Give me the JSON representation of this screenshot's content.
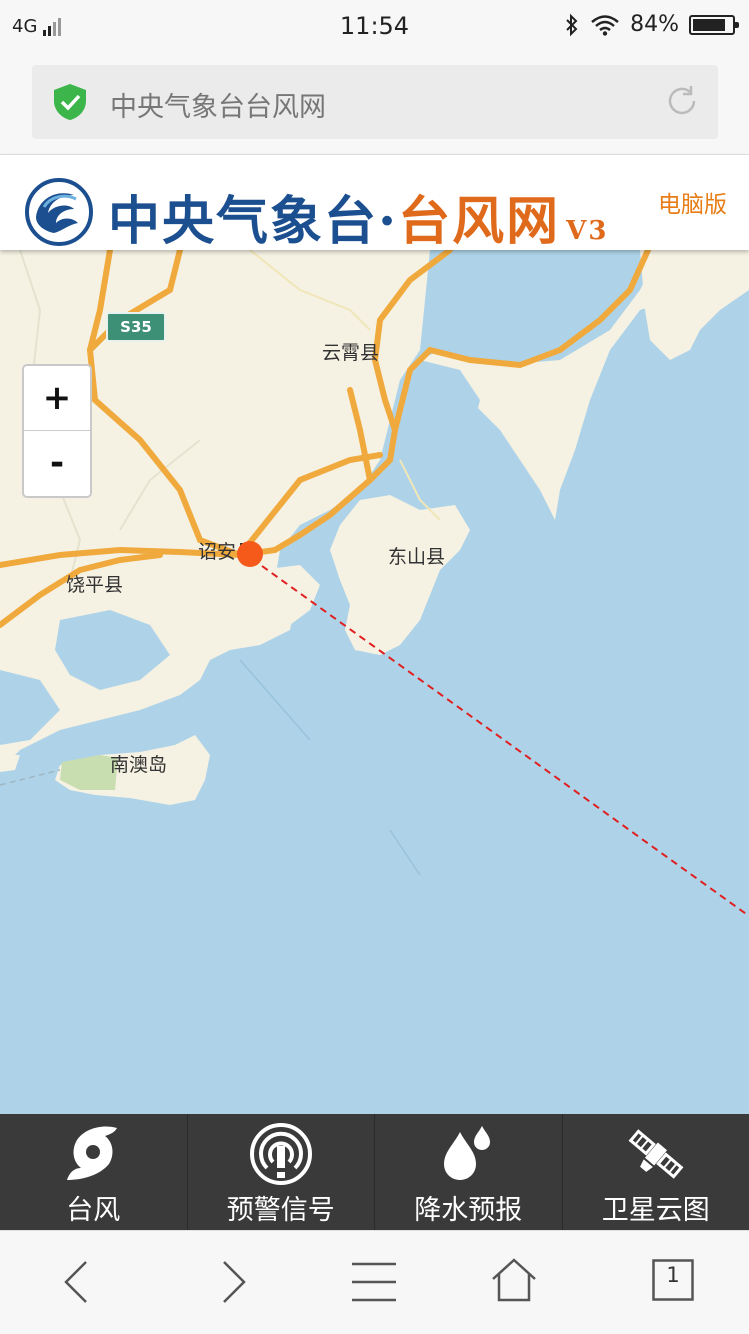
{
  "status_bar": {
    "network": "4G",
    "time": "11:54",
    "battery": "84%",
    "battery_level": 0.84
  },
  "address_bar": {
    "url_text": "中央气象台台风网"
  },
  "site_header": {
    "title_part1": "中央气象台",
    "title_dot": "·",
    "title_part2": "台风网",
    "version": "V3",
    "pc_version_link": "电脑版"
  },
  "map": {
    "labels": {
      "yunxiao": "云霄县",
      "zhaoan": "诏安县",
      "raoping": "饶平县",
      "dongshan": "东山县",
      "nanao": "南澳岛"
    },
    "road_shield": "S35",
    "zoom_in": "+",
    "zoom_out": "-",
    "colors": {
      "sea": "#aed3e8",
      "land": "#f5f2e3",
      "road": "#f0a93c",
      "track": "#e02020",
      "marker": "#f65a1a"
    }
  },
  "app_nav": [
    {
      "label": "台风",
      "icon": "typhoon-icon"
    },
    {
      "label": "预警信号",
      "icon": "warning-signal-icon"
    },
    {
      "label": "降水预报",
      "icon": "rain-drops-icon"
    },
    {
      "label": "卫星云图",
      "icon": "satellite-icon"
    }
  ],
  "browser_toolbar": {
    "tab_count": "1"
  }
}
